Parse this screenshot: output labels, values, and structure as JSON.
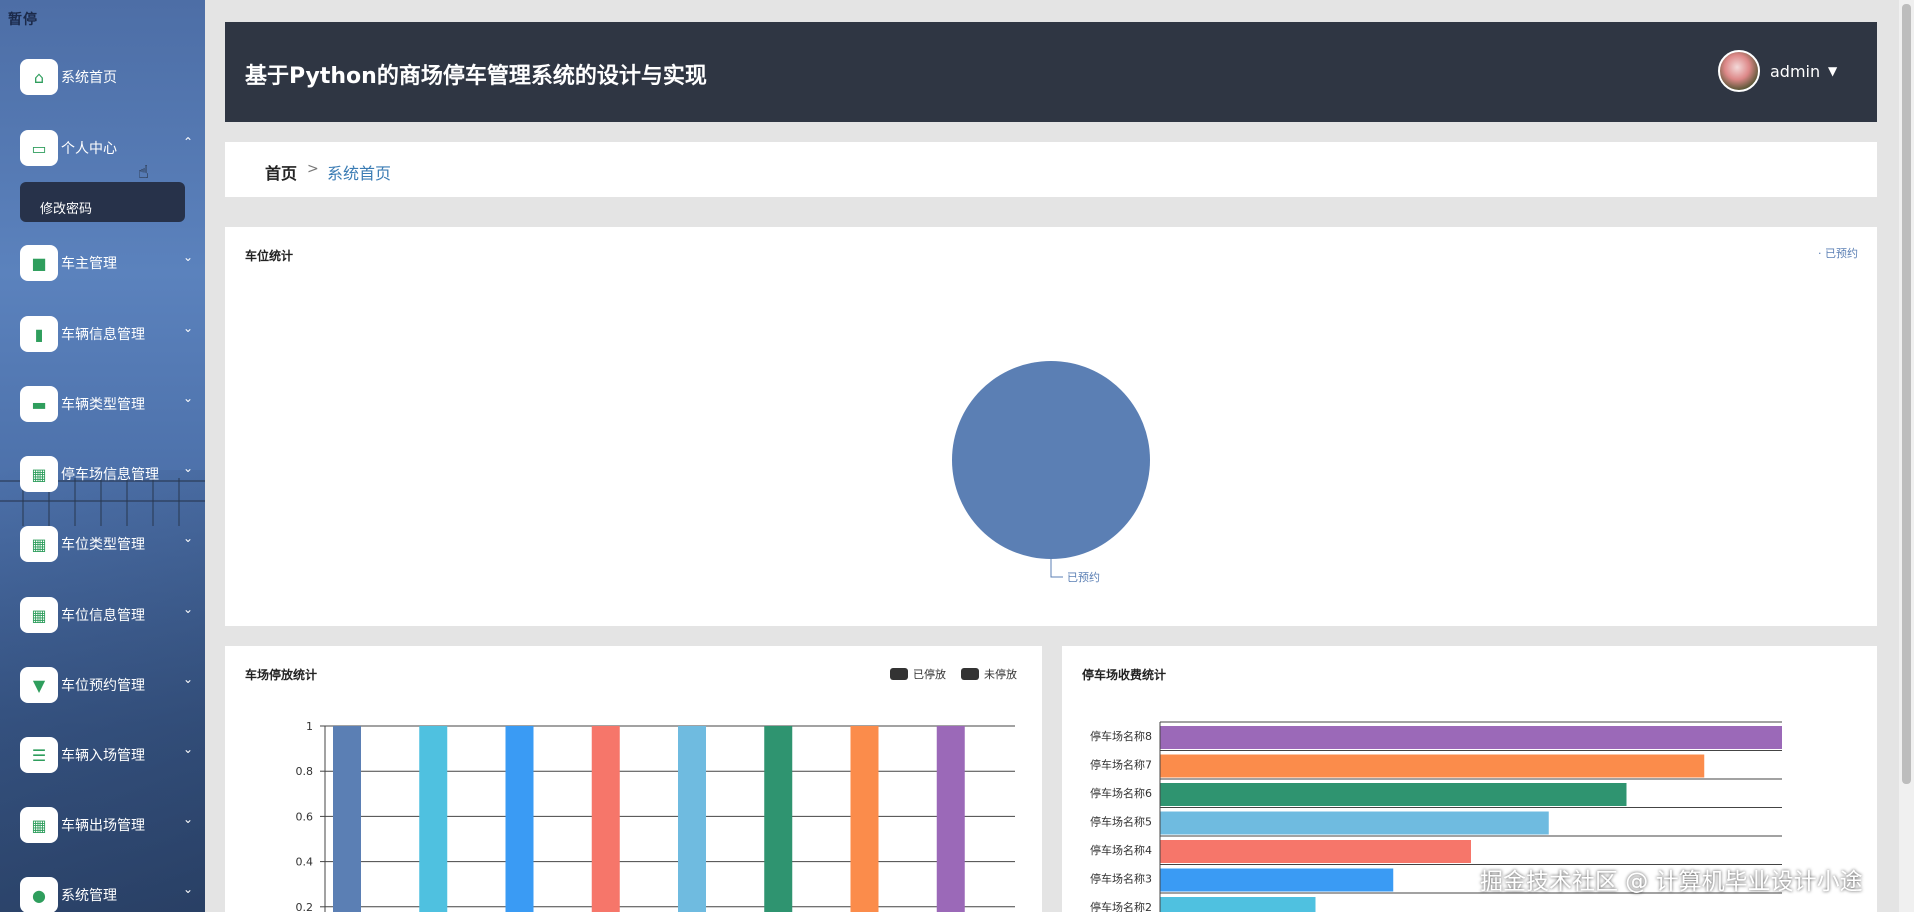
{
  "sidebar": {
    "brand": "暂停",
    "items": [
      {
        "label": "系统首页",
        "icon": "home-icon",
        "glyph": "⌂",
        "chevron": ""
      },
      {
        "label": "个人中心",
        "icon": "card-icon",
        "glyph": "▭",
        "chevron": "⌃"
      },
      {
        "label": "车主管理",
        "icon": "briefcase-icon",
        "glyph": "■",
        "chevron": "⌄"
      },
      {
        "label": "车辆信息管理",
        "icon": "clipboard-icon",
        "glyph": "▮",
        "chevron": "⌄"
      },
      {
        "label": "车辆类型管理",
        "icon": "monitor-icon",
        "glyph": "▬",
        "chevron": "⌄"
      },
      {
        "label": "停车场信息管理",
        "icon": "grid-icon",
        "glyph": "▦",
        "chevron": "⌄"
      },
      {
        "label": "车位类型管理",
        "icon": "grid-icon",
        "glyph": "▦",
        "chevron": "⌄"
      },
      {
        "label": "车位信息管理",
        "icon": "grid-icon",
        "glyph": "▦",
        "chevron": "⌄"
      },
      {
        "label": "车位预约管理",
        "icon": "stamp-icon",
        "glyph": "▼",
        "chevron": "⌄"
      },
      {
        "label": "车辆入场管理",
        "icon": "sliders-icon",
        "glyph": "☰",
        "chevron": "⌄"
      },
      {
        "label": "车辆出场管理",
        "icon": "grid-icon",
        "glyph": "▦",
        "chevron": "⌄"
      },
      {
        "label": "系统管理",
        "icon": "user-icon",
        "glyph": "●",
        "chevron": "⌄"
      }
    ],
    "submenu_label": "修改密码"
  },
  "header": {
    "title": "基于Python的商场停车管理系统的设计与实现",
    "username": "admin",
    "caret": "▼"
  },
  "breadcrumb": {
    "home": "首页",
    "separator": ">",
    "current": "系统首页"
  },
  "watermark": "掘金技术社区 @ 计算机毕业设计小途",
  "chart_data": [
    {
      "type": "pie",
      "title": "车位统计",
      "legend": [
        "已预约"
      ],
      "labels": [
        "已预约"
      ],
      "values": [
        1
      ],
      "colors": [
        "#5b7fb4"
      ],
      "legend_position": "top-right"
    },
    {
      "type": "bar",
      "title": "车场停放统计",
      "legend": [
        "已停放",
        "未停放"
      ],
      "legend_position": "top-right",
      "ylim": [
        0,
        1
      ],
      "yticks": [
        "1",
        "0.8",
        "0.6",
        "0.4",
        "0.2"
      ],
      "values": [
        1,
        1,
        1,
        1,
        1,
        1,
        1,
        1
      ],
      "colors": [
        "#5b7fb4",
        "#4fc1e0",
        "#3a9bf4",
        "#f6766a",
        "#6fbbe0",
        "#2f9470",
        "#fb8c4b",
        "#9b69b8"
      ]
    },
    {
      "type": "bar",
      "orientation": "horizontal",
      "title": "停车场收费统计",
      "categories": [
        "停车场名称8",
        "停车场名称7",
        "停车场名称6",
        "停车场名称5",
        "停车场名称4",
        "停车场名称3",
        "停车场名称2"
      ],
      "values": [
        8,
        7,
        6,
        5,
        4,
        3,
        2
      ],
      "xlim": [
        0,
        8
      ],
      "colors": [
        "#9b69b8",
        "#fb8c4b",
        "#2f9470",
        "#6fbbe0",
        "#f6766a",
        "#3a9bf4",
        "#4fc1e0"
      ]
    }
  ]
}
